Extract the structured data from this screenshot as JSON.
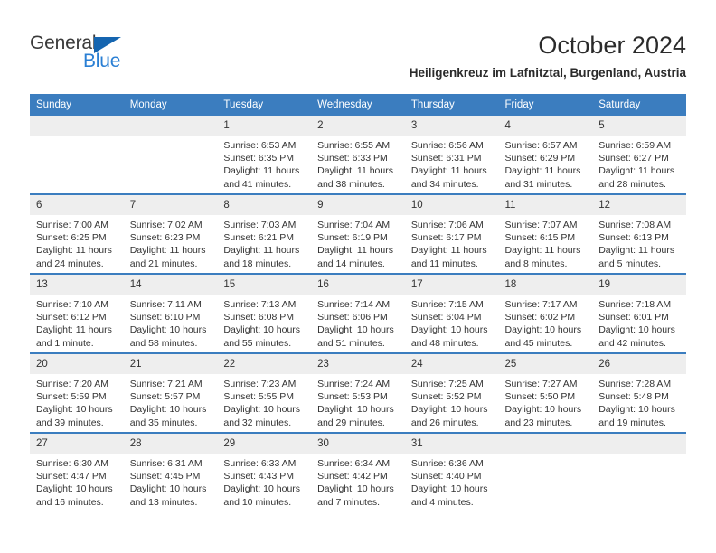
{
  "brand": {
    "name_part1": "General",
    "name_part2": "Blue",
    "accent_color": "#2a7fd4",
    "triangle_color": "#1565b0"
  },
  "header": {
    "month_title": "October 2024",
    "location": "Heiligenkreuz im Lafnitztal, Burgenland, Austria"
  },
  "theme": {
    "header_row_color": "#3b7dbf",
    "day_band_color": "#eeeeee",
    "separator_color": "#3b7dbf"
  },
  "weekday_headers": [
    "Sunday",
    "Monday",
    "Tuesday",
    "Wednesday",
    "Thursday",
    "Friday",
    "Saturday"
  ],
  "weeks": [
    {
      "days": [
        {
          "date": "",
          "empty": true,
          "sunrise": "",
          "sunset": "",
          "daylight_line1": "",
          "daylight_line2": ""
        },
        {
          "date": "",
          "empty": true,
          "sunrise": "",
          "sunset": "",
          "daylight_line1": "",
          "daylight_line2": ""
        },
        {
          "date": "1",
          "empty": false,
          "sunrise": "Sunrise: 6:53 AM",
          "sunset": "Sunset: 6:35 PM",
          "daylight_line1": "Daylight: 11 hours",
          "daylight_line2": "and 41 minutes."
        },
        {
          "date": "2",
          "empty": false,
          "sunrise": "Sunrise: 6:55 AM",
          "sunset": "Sunset: 6:33 PM",
          "daylight_line1": "Daylight: 11 hours",
          "daylight_line2": "and 38 minutes."
        },
        {
          "date": "3",
          "empty": false,
          "sunrise": "Sunrise: 6:56 AM",
          "sunset": "Sunset: 6:31 PM",
          "daylight_line1": "Daylight: 11 hours",
          "daylight_line2": "and 34 minutes."
        },
        {
          "date": "4",
          "empty": false,
          "sunrise": "Sunrise: 6:57 AM",
          "sunset": "Sunset: 6:29 PM",
          "daylight_line1": "Daylight: 11 hours",
          "daylight_line2": "and 31 minutes."
        },
        {
          "date": "5",
          "empty": false,
          "sunrise": "Sunrise: 6:59 AM",
          "sunset": "Sunset: 6:27 PM",
          "daylight_line1": "Daylight: 11 hours",
          "daylight_line2": "and 28 minutes."
        }
      ]
    },
    {
      "days": [
        {
          "date": "6",
          "empty": false,
          "sunrise": "Sunrise: 7:00 AM",
          "sunset": "Sunset: 6:25 PM",
          "daylight_line1": "Daylight: 11 hours",
          "daylight_line2": "and 24 minutes."
        },
        {
          "date": "7",
          "empty": false,
          "sunrise": "Sunrise: 7:02 AM",
          "sunset": "Sunset: 6:23 PM",
          "daylight_line1": "Daylight: 11 hours",
          "daylight_line2": "and 21 minutes."
        },
        {
          "date": "8",
          "empty": false,
          "sunrise": "Sunrise: 7:03 AM",
          "sunset": "Sunset: 6:21 PM",
          "daylight_line1": "Daylight: 11 hours",
          "daylight_line2": "and 18 minutes."
        },
        {
          "date": "9",
          "empty": false,
          "sunrise": "Sunrise: 7:04 AM",
          "sunset": "Sunset: 6:19 PM",
          "daylight_line1": "Daylight: 11 hours",
          "daylight_line2": "and 14 minutes."
        },
        {
          "date": "10",
          "empty": false,
          "sunrise": "Sunrise: 7:06 AM",
          "sunset": "Sunset: 6:17 PM",
          "daylight_line1": "Daylight: 11 hours",
          "daylight_line2": "and 11 minutes."
        },
        {
          "date": "11",
          "empty": false,
          "sunrise": "Sunrise: 7:07 AM",
          "sunset": "Sunset: 6:15 PM",
          "daylight_line1": "Daylight: 11 hours",
          "daylight_line2": "and 8 minutes."
        },
        {
          "date": "12",
          "empty": false,
          "sunrise": "Sunrise: 7:08 AM",
          "sunset": "Sunset: 6:13 PM",
          "daylight_line1": "Daylight: 11 hours",
          "daylight_line2": "and 5 minutes."
        }
      ]
    },
    {
      "days": [
        {
          "date": "13",
          "empty": false,
          "sunrise": "Sunrise: 7:10 AM",
          "sunset": "Sunset: 6:12 PM",
          "daylight_line1": "Daylight: 11 hours",
          "daylight_line2": "and 1 minute."
        },
        {
          "date": "14",
          "empty": false,
          "sunrise": "Sunrise: 7:11 AM",
          "sunset": "Sunset: 6:10 PM",
          "daylight_line1": "Daylight: 10 hours",
          "daylight_line2": "and 58 minutes."
        },
        {
          "date": "15",
          "empty": false,
          "sunrise": "Sunrise: 7:13 AM",
          "sunset": "Sunset: 6:08 PM",
          "daylight_line1": "Daylight: 10 hours",
          "daylight_line2": "and 55 minutes."
        },
        {
          "date": "16",
          "empty": false,
          "sunrise": "Sunrise: 7:14 AM",
          "sunset": "Sunset: 6:06 PM",
          "daylight_line1": "Daylight: 10 hours",
          "daylight_line2": "and 51 minutes."
        },
        {
          "date": "17",
          "empty": false,
          "sunrise": "Sunrise: 7:15 AM",
          "sunset": "Sunset: 6:04 PM",
          "daylight_line1": "Daylight: 10 hours",
          "daylight_line2": "and 48 minutes."
        },
        {
          "date": "18",
          "empty": false,
          "sunrise": "Sunrise: 7:17 AM",
          "sunset": "Sunset: 6:02 PM",
          "daylight_line1": "Daylight: 10 hours",
          "daylight_line2": "and 45 minutes."
        },
        {
          "date": "19",
          "empty": false,
          "sunrise": "Sunrise: 7:18 AM",
          "sunset": "Sunset: 6:01 PM",
          "daylight_line1": "Daylight: 10 hours",
          "daylight_line2": "and 42 minutes."
        }
      ]
    },
    {
      "days": [
        {
          "date": "20",
          "empty": false,
          "sunrise": "Sunrise: 7:20 AM",
          "sunset": "Sunset: 5:59 PM",
          "daylight_line1": "Daylight: 10 hours",
          "daylight_line2": "and 39 minutes."
        },
        {
          "date": "21",
          "empty": false,
          "sunrise": "Sunrise: 7:21 AM",
          "sunset": "Sunset: 5:57 PM",
          "daylight_line1": "Daylight: 10 hours",
          "daylight_line2": "and 35 minutes."
        },
        {
          "date": "22",
          "empty": false,
          "sunrise": "Sunrise: 7:23 AM",
          "sunset": "Sunset: 5:55 PM",
          "daylight_line1": "Daylight: 10 hours",
          "daylight_line2": "and 32 minutes."
        },
        {
          "date": "23",
          "empty": false,
          "sunrise": "Sunrise: 7:24 AM",
          "sunset": "Sunset: 5:53 PM",
          "daylight_line1": "Daylight: 10 hours",
          "daylight_line2": "and 29 minutes."
        },
        {
          "date": "24",
          "empty": false,
          "sunrise": "Sunrise: 7:25 AM",
          "sunset": "Sunset: 5:52 PM",
          "daylight_line1": "Daylight: 10 hours",
          "daylight_line2": "and 26 minutes."
        },
        {
          "date": "25",
          "empty": false,
          "sunrise": "Sunrise: 7:27 AM",
          "sunset": "Sunset: 5:50 PM",
          "daylight_line1": "Daylight: 10 hours",
          "daylight_line2": "and 23 minutes."
        },
        {
          "date": "26",
          "empty": false,
          "sunrise": "Sunrise: 7:28 AM",
          "sunset": "Sunset: 5:48 PM",
          "daylight_line1": "Daylight: 10 hours",
          "daylight_line2": "and 19 minutes."
        }
      ]
    },
    {
      "days": [
        {
          "date": "27",
          "empty": false,
          "sunrise": "Sunrise: 6:30 AM",
          "sunset": "Sunset: 4:47 PM",
          "daylight_line1": "Daylight: 10 hours",
          "daylight_line2": "and 16 minutes."
        },
        {
          "date": "28",
          "empty": false,
          "sunrise": "Sunrise: 6:31 AM",
          "sunset": "Sunset: 4:45 PM",
          "daylight_line1": "Daylight: 10 hours",
          "daylight_line2": "and 13 minutes."
        },
        {
          "date": "29",
          "empty": false,
          "sunrise": "Sunrise: 6:33 AM",
          "sunset": "Sunset: 4:43 PM",
          "daylight_line1": "Daylight: 10 hours",
          "daylight_line2": "and 10 minutes."
        },
        {
          "date": "30",
          "empty": false,
          "sunrise": "Sunrise: 6:34 AM",
          "sunset": "Sunset: 4:42 PM",
          "daylight_line1": "Daylight: 10 hours",
          "daylight_line2": "and 7 minutes."
        },
        {
          "date": "31",
          "empty": false,
          "sunrise": "Sunrise: 6:36 AM",
          "sunset": "Sunset: 4:40 PM",
          "daylight_line1": "Daylight: 10 hours",
          "daylight_line2": "and 4 minutes."
        },
        {
          "date": "",
          "empty": true,
          "sunrise": "",
          "sunset": "",
          "daylight_line1": "",
          "daylight_line2": ""
        },
        {
          "date": "",
          "empty": true,
          "sunrise": "",
          "sunset": "",
          "daylight_line1": "",
          "daylight_line2": ""
        }
      ]
    }
  ]
}
